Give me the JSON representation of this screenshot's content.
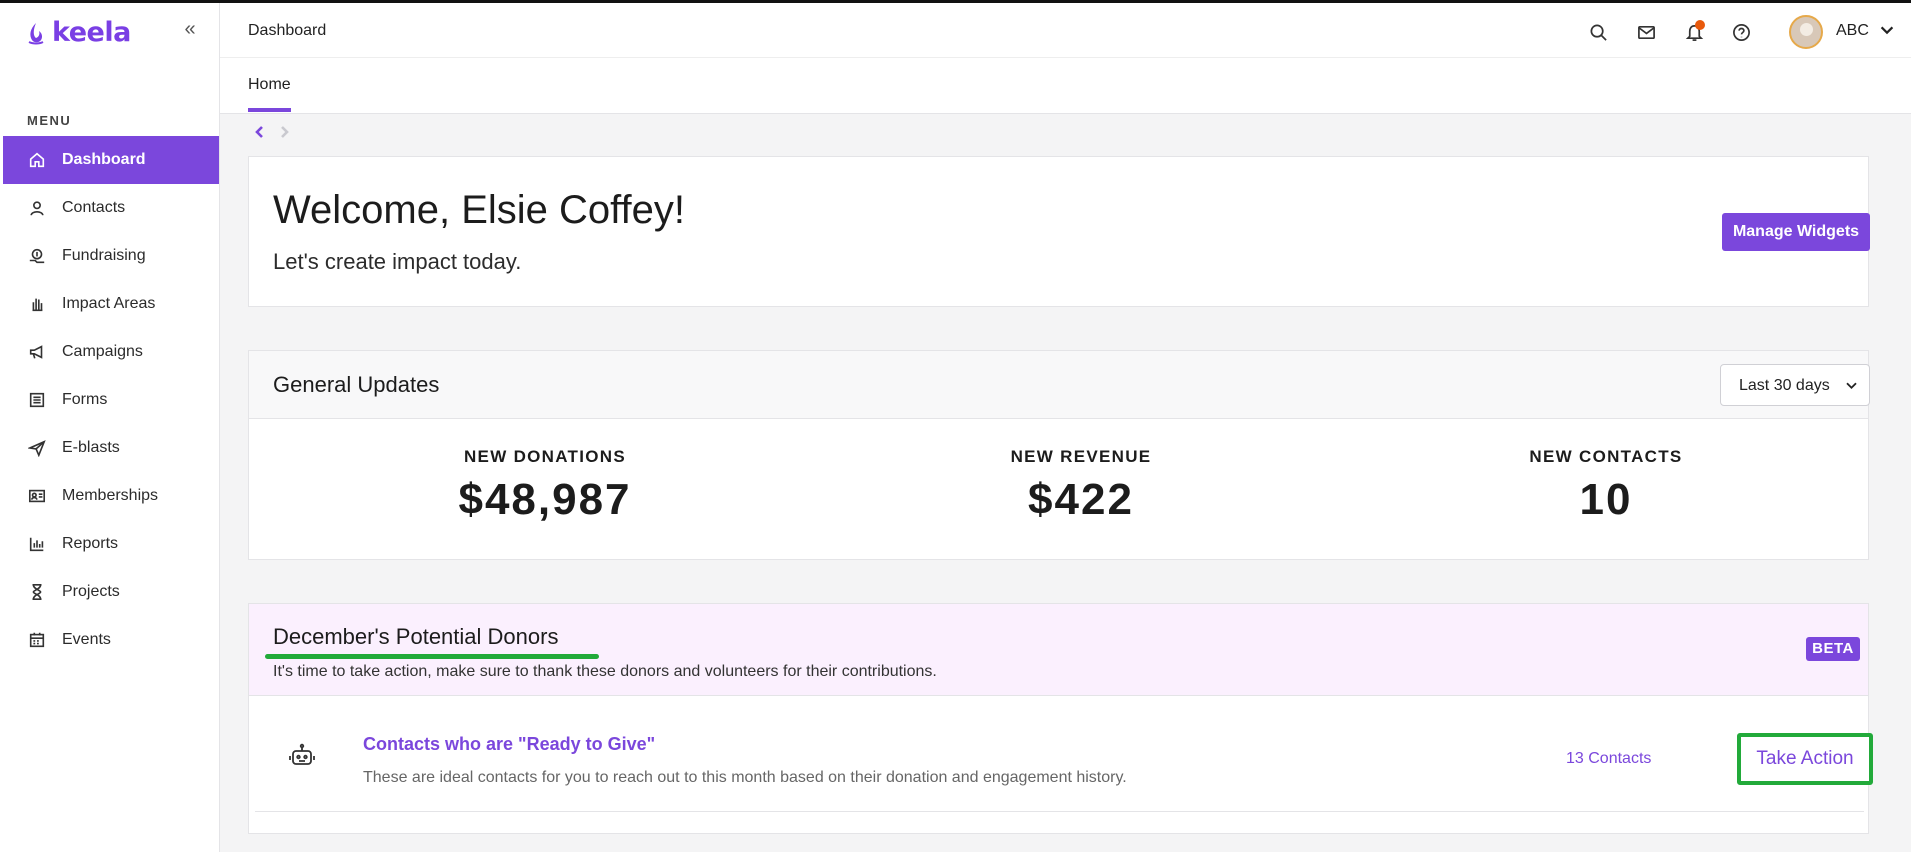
{
  "app": {
    "logo_text": "keela",
    "brand_color": "#7b47dc"
  },
  "sidebar": {
    "menu_title": "MENU",
    "items": [
      {
        "label": "Dashboard",
        "icon": "home-icon",
        "active": true
      },
      {
        "label": "Contacts",
        "icon": "user-icon"
      },
      {
        "label": "Fundraising",
        "icon": "donation-icon"
      },
      {
        "label": "Impact Areas",
        "icon": "hand-icon"
      },
      {
        "label": "Campaigns",
        "icon": "megaphone-icon"
      },
      {
        "label": "Forms",
        "icon": "form-icon"
      },
      {
        "label": "E-blasts",
        "icon": "paper-plane-icon"
      },
      {
        "label": "Memberships",
        "icon": "id-card-icon"
      },
      {
        "label": "Reports",
        "icon": "bar-chart-icon"
      },
      {
        "label": "Projects",
        "icon": "hourglass-icon"
      },
      {
        "label": "Events",
        "icon": "calendar-icon"
      }
    ]
  },
  "header": {
    "title": "Dashboard",
    "user_name": "ABC"
  },
  "tabs": [
    {
      "label": "Home",
      "active": true
    }
  ],
  "welcome": {
    "heading": "Welcome, Elsie Coffey!",
    "subheading": "Let's create impact today.",
    "manage_button": "Manage Widgets"
  },
  "updates": {
    "title": "General Updates",
    "range": "Last 30 days",
    "stats": [
      {
        "label": "NEW DONATIONS",
        "value": "$48,987"
      },
      {
        "label": "NEW REVENUE",
        "value": "$422"
      },
      {
        "label": "NEW CONTACTS",
        "value": "10"
      }
    ]
  },
  "donors": {
    "title": "December's Potential Donors",
    "description": "It's time to take action, make sure to thank these donors and volunteers for their contributions.",
    "badge": "BETA",
    "row": {
      "title": "Contacts who are \"Ready to Give\"",
      "description": "These are ideal contacts for you to reach out to this month based on their donation and engagement history.",
      "count": "13 Contacts",
      "action": "Take Action"
    }
  }
}
